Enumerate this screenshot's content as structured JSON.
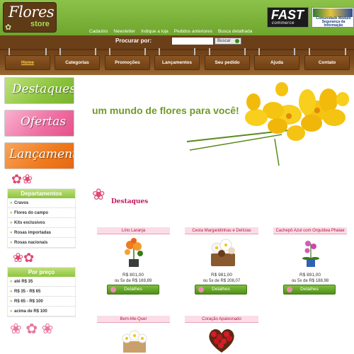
{
  "brand": {
    "name": "Flores",
    "sub": "store"
  },
  "partners": {
    "fast_main": "FAST",
    "fast_sub": "commerce",
    "community": "Comunidade Módulo Segurança da Informação"
  },
  "toplinks": [
    "Cadastro",
    "Newsletter",
    "Indique a loja",
    "Pedidos anteriores",
    "Busca detalhada"
  ],
  "search": {
    "label": "Procurar por:",
    "value": "",
    "button": "Buscar"
  },
  "nav": [
    {
      "label": "Home",
      "active": true
    },
    {
      "label": "Categorias"
    },
    {
      "label": "Promoções"
    },
    {
      "label": "Lançamentos"
    },
    {
      "label": "Seu pedido"
    },
    {
      "label": "Ajuda"
    },
    {
      "label": "Contato"
    }
  ],
  "banners": [
    "Destaques",
    "Ofertas",
    "Lançamentos"
  ],
  "hero": {
    "tagline": "um mundo de flores para você!"
  },
  "departments": {
    "title": "Departamentos",
    "items": [
      "Cravos",
      "Flores do campo",
      "Kits exclusivos",
      "Rosas importadas",
      "Rosas nacionais"
    ]
  },
  "price_filter": {
    "title": "Por preço",
    "items": [
      "até R$ 35",
      "R$ 35 - R$ 65",
      "R$ 65 - R$ 100",
      "acima de R$ 100"
    ]
  },
  "section": {
    "title": "Destaques"
  },
  "products": [
    {
      "name": "Lírio Laranja",
      "price": "R$ 801,00",
      "installments": "ou 5x de R$ 169,89",
      "button": "Detalhes"
    },
    {
      "name": "Cesta Margaridinhas e Delícias",
      "price": "R$ 981,00",
      "installments": "ou 5x de R$ 208,07",
      "button": "Detalhes"
    },
    {
      "name": "Cachepô Azul com Orquídea Phalae",
      "price": "R$ 891,00",
      "installments": "ou 5x de R$ 188,98",
      "button": "Detalhes"
    },
    {
      "name": "Bem-Me-Quer",
      "price": "",
      "installments": "",
      "button": ""
    },
    {
      "name": "Coração Apaixonado",
      "price": "",
      "installments": "",
      "button": ""
    }
  ],
  "colors": {
    "green": "#8cc43e",
    "brown": "#6b3f18",
    "pink": "#c2185b"
  }
}
